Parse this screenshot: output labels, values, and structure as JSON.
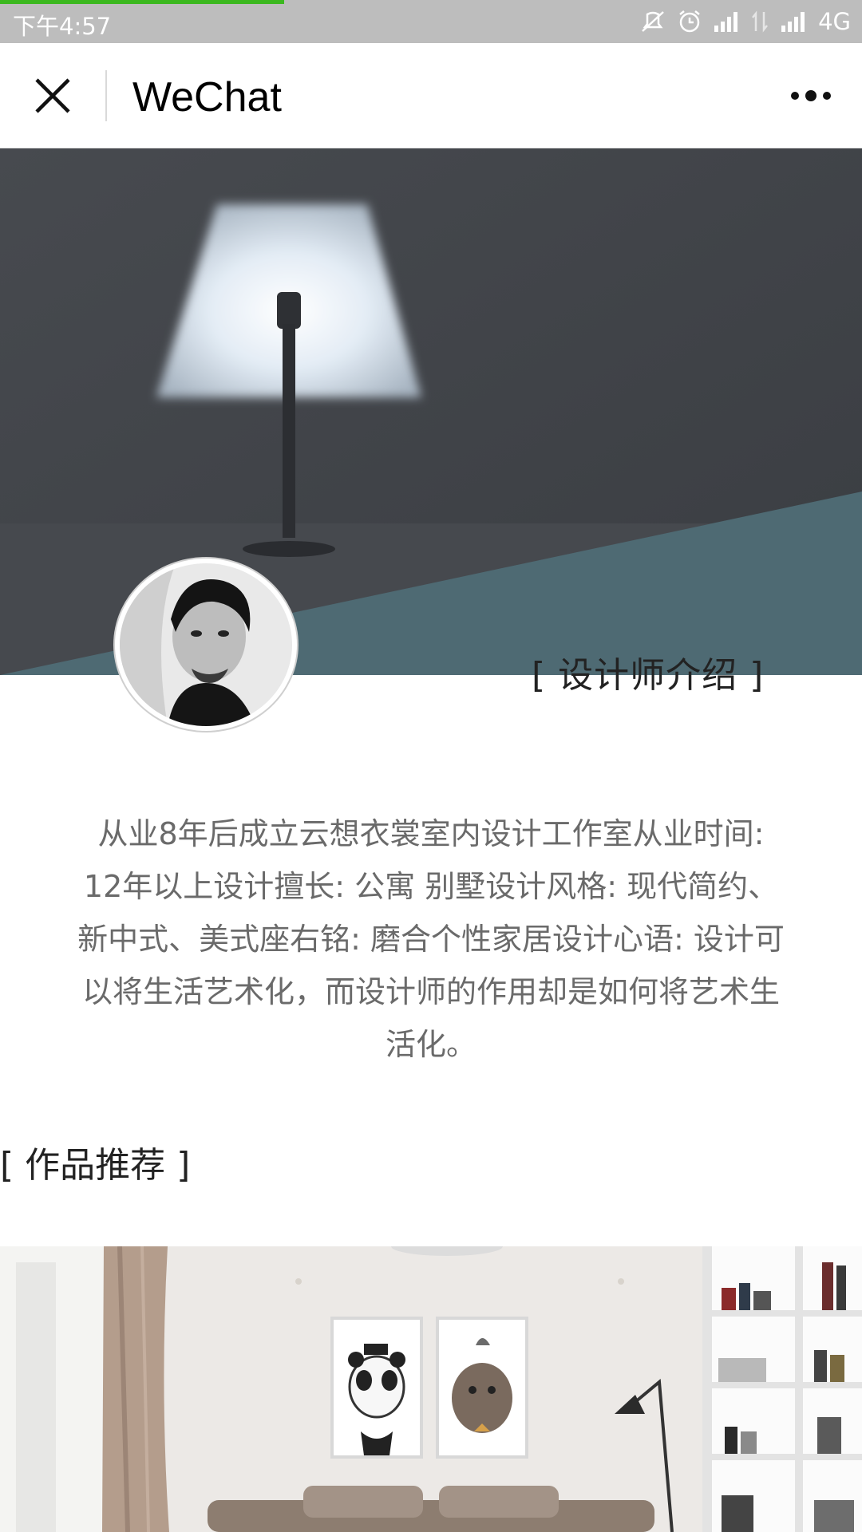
{
  "status_bar": {
    "time": "下午4:57",
    "network": "4G",
    "icons": [
      "mute-vibrate-icon",
      "alarm-icon",
      "signal-icon",
      "data-arrows-icon",
      "signal-icon"
    ]
  },
  "nav": {
    "title": "WeChat",
    "close_icon": "close-icon",
    "more_icon": "more-icon"
  },
  "profile": {
    "section_label": "[ 设计师介绍 ]",
    "bio": "从业8年后成立云想衣裳室内设计工作室从业时间: 12年以上设计擅长: 公寓 别墅设计风格: 现代简约、新中式、美式座右铭: 磨合个性家居设计心语: 设计可以将生活艺术化，而设计师的作用却是如何将艺术生活化。"
  },
  "works": {
    "section_label": "[ 作品推荐 ]"
  },
  "colors": {
    "status_bar": "#bdbdbd",
    "progress": "#3bb81f",
    "hero_wall": "#3d4045",
    "hero_accent": "#4e6a73"
  }
}
